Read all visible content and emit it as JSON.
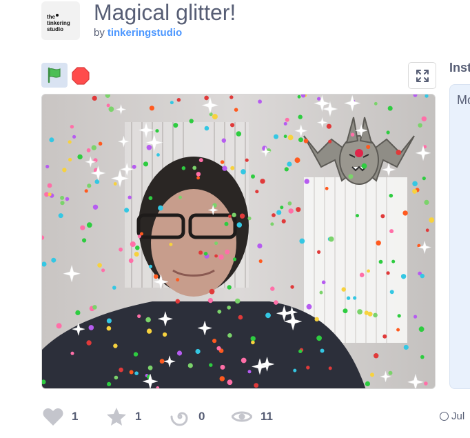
{
  "project": {
    "title": "Magical glitter!",
    "by_label": "by",
    "author": "tinkeringstudio"
  },
  "logo": {
    "text": "the\ntinkering\nstudio"
  },
  "controls": {
    "green_flag_icon": "green-flag-icon",
    "stop_icon": "stop-sign-icon",
    "fullscreen_icon": "fullscreen-icon"
  },
  "instructions": {
    "label": "Inst",
    "text": "Mo"
  },
  "stats": {
    "loves": "1",
    "favorites": "1",
    "remixes": "0",
    "views": "11"
  },
  "date": {
    "text": "Jul"
  },
  "colors": {
    "accent": "#4c97ff",
    "text": "#575e75",
    "flag_bg": "#d9e3f2",
    "stop_red": "#ff4c4c",
    "flag_green": "#4cbf56",
    "icon_gray": "#575e75"
  }
}
